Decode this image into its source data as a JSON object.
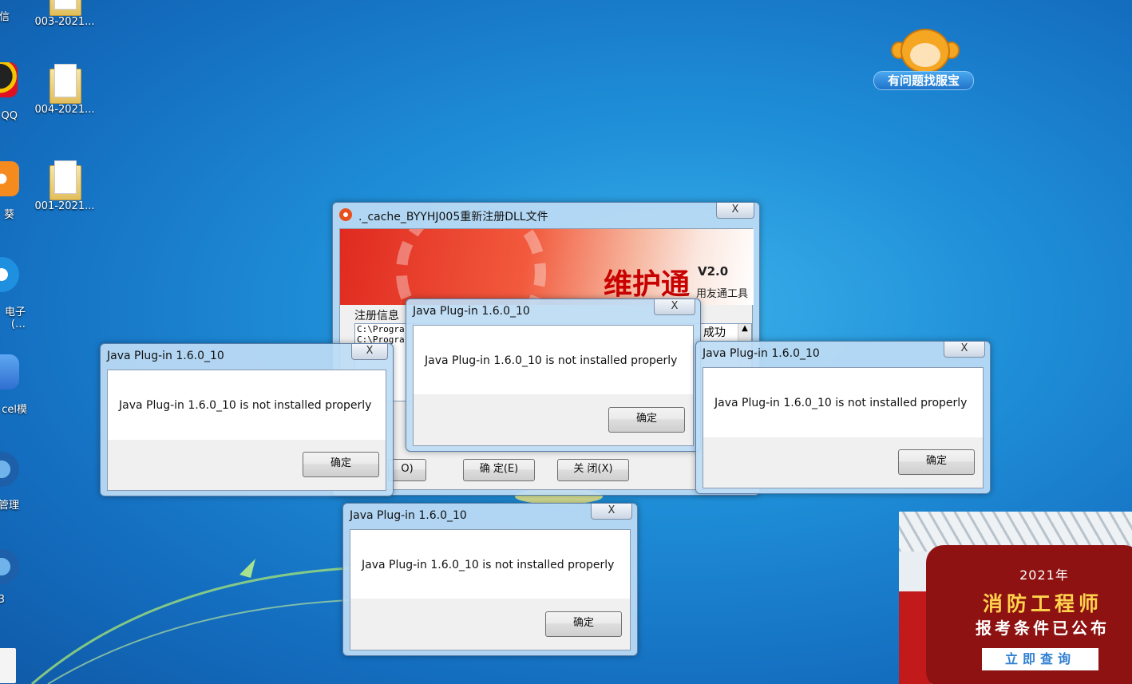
{
  "desktop": {
    "left_labels": [
      "信",
      "QQ",
      "葵",
      "电子",
      "(…",
      "cel模",
      "管理",
      "3"
    ],
    "folders": [
      "003-2021...",
      "004-2021...",
      "001-2021..."
    ]
  },
  "mascot": {
    "label": "有问题找服宝"
  },
  "main_window": {
    "title": "._cache_BYYHJ005重新注册DLL文件",
    "brand": "维护通",
    "version": "V2.0",
    "subtitle": "用友通工具",
    "group_label": "注册信息",
    "log_line": "C:\\Progra",
    "status_text": "成功",
    "ok_button": "确 定(E)",
    "close_button": "关 闭(X)",
    "left_partial_button": "O)"
  },
  "dialogs": [
    {
      "title": "Java Plug-in 1.6.0_10",
      "message": "Java Plug-in 1.6.0_10 is not installed properly",
      "ok_label": "确定"
    },
    {
      "title": "Java Plug-in 1.6.0_10",
      "message": "Java Plug-in 1.6.0_10 is not installed properly",
      "ok_label": "确定"
    },
    {
      "title": "Java Plug-in 1.6.0_10",
      "message": "Java Plug-in 1.6.0_10 is not installed properly",
      "ok_label": "确定"
    },
    {
      "title": "Java Plug-in 1.6.0_10",
      "message": "Java Plug-in 1.6.0_10 is not installed properly",
      "ok_label": "确定"
    }
  ],
  "close_glyph": "X",
  "ad": {
    "year": "2021年",
    "headline": "消防工程师",
    "subheadline": "报考条件已公布",
    "cta": "立即查询"
  }
}
